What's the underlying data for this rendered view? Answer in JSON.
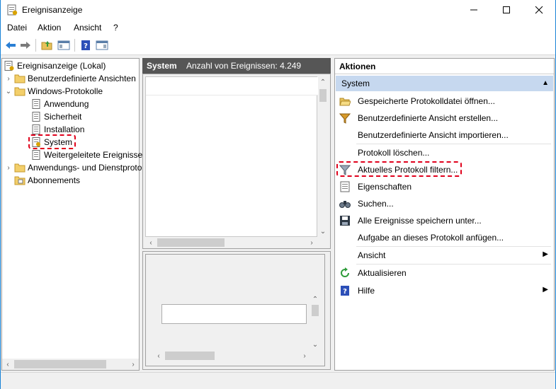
{
  "window": {
    "title": "Ereignisanzeige"
  },
  "menu": [
    "Datei",
    "Aktion",
    "Ansicht",
    "?"
  ],
  "tree": {
    "root": "Ereignisanzeige (Lokal)",
    "items": [
      {
        "label": "Benutzerdefinierte Ansichten"
      },
      {
        "label": "Windows-Protokolle"
      },
      {
        "label": "Anwendung"
      },
      {
        "label": "Sicherheit"
      },
      {
        "label": "Installation"
      },
      {
        "label": "System"
      },
      {
        "label": "Weitergeleitete Ereignisse"
      },
      {
        "label": "Anwendungs- und Dienstprotokolle"
      },
      {
        "label": "Abonnements"
      }
    ]
  },
  "middle": {
    "log_name": "System",
    "event_count": "Anzahl von Ereignissen: 4.249"
  },
  "actions": {
    "header": "Aktionen",
    "section": "System",
    "items": [
      "Gespeicherte Protokolldatei öffnen...",
      "Benutzerdefinierte Ansicht erstellen...",
      "Benutzerdefinierte Ansicht importieren...",
      "Protokoll löschen...",
      "Aktuelles Protokoll filtern...",
      "Eigenschaften",
      "Suchen...",
      "Alle Ereignisse speichern unter...",
      "Aufgabe an dieses Protokoll anfügen...",
      "Ansicht",
      "Aktualisieren",
      "Hilfe"
    ]
  },
  "colors": {
    "highlight_dash": "#e0001b",
    "section_bg": "#c6d8ef",
    "pane_header_bg": "#565656"
  }
}
